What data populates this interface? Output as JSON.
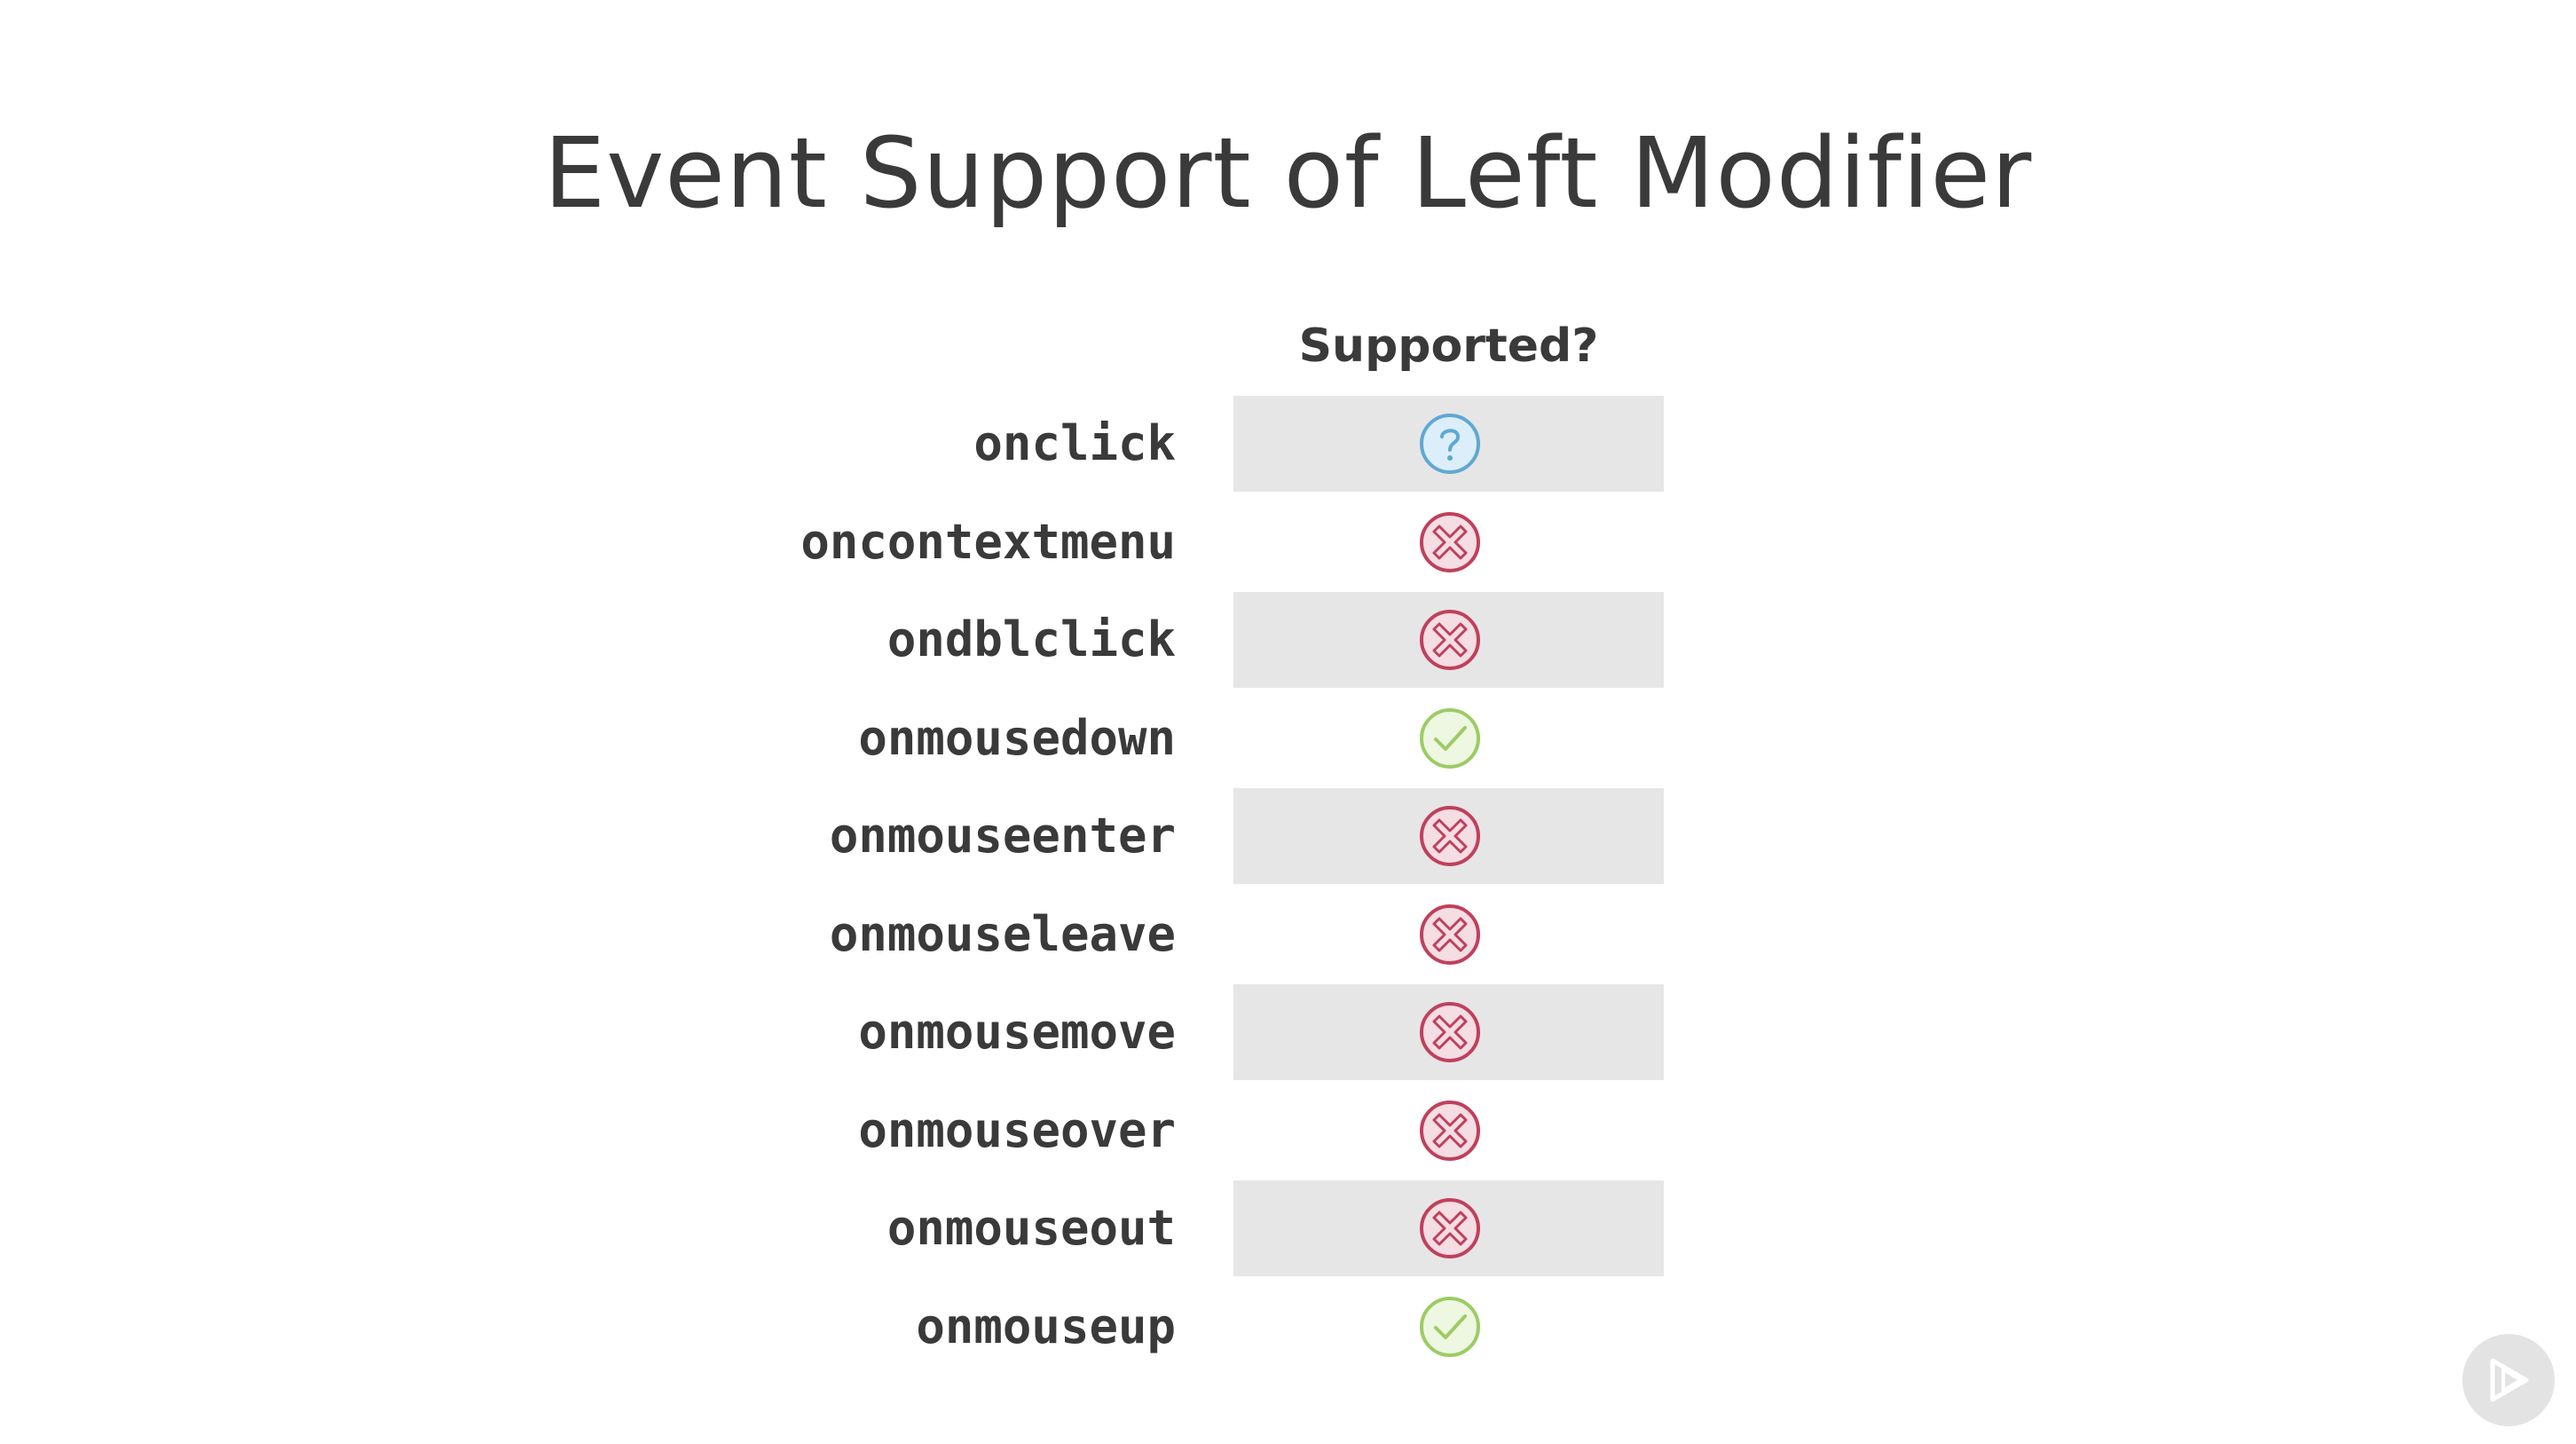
{
  "slide": {
    "title": "Event Support of Left Modifier",
    "column_header": "Supported?"
  },
  "rows": [
    {
      "event": "onclick",
      "status": "unknown"
    },
    {
      "event": "oncontextmenu",
      "status": "no"
    },
    {
      "event": "ondblclick",
      "status": "no"
    },
    {
      "event": "onmousedown",
      "status": "yes"
    },
    {
      "event": "onmouseenter",
      "status": "no"
    },
    {
      "event": "onmouseleave",
      "status": "no"
    },
    {
      "event": "onmousemove",
      "status": "no"
    },
    {
      "event": "onmouseover",
      "status": "no"
    },
    {
      "event": "onmouseout",
      "status": "no"
    },
    {
      "event": "onmouseup",
      "status": "yes"
    }
  ],
  "status_icons": {
    "unknown": "question-circle-icon",
    "no": "x-circle-icon",
    "yes": "check-circle-icon"
  },
  "colors": {
    "unknown": "#5fa8d3",
    "no": "#c0405c",
    "yes": "#9ccc65",
    "row_shade": "#e6e6e6",
    "text": "#3a3a3a"
  },
  "player": {
    "icon": "play-logo-icon"
  }
}
